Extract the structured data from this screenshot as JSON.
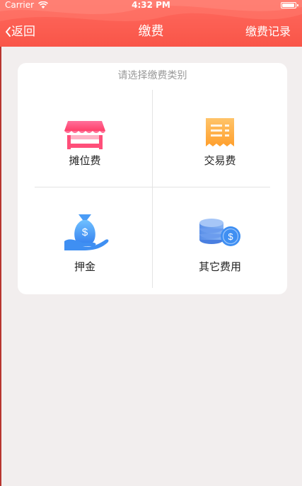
{
  "status_bar": {
    "carrier": "Carrier",
    "time": "4:32 PM"
  },
  "nav": {
    "back_label": "返回",
    "title": "缴费",
    "record_label": "缴费记录"
  },
  "panel": {
    "prompt": "请选择缴费类别",
    "items": [
      {
        "label": "摊位费",
        "icon": "stall-icon"
      },
      {
        "label": "交易费",
        "icon": "receipt-icon"
      },
      {
        "label": "押金",
        "icon": "money-bag-icon"
      },
      {
        "label": "其它费用",
        "icon": "coin-stack-icon"
      }
    ]
  },
  "colors": {
    "header": "#f95548",
    "accent_pink": "#ff4f7a",
    "accent_orange": "#ffac3c",
    "accent_blue": "#3f8ff2",
    "background": "#f2eeee"
  }
}
